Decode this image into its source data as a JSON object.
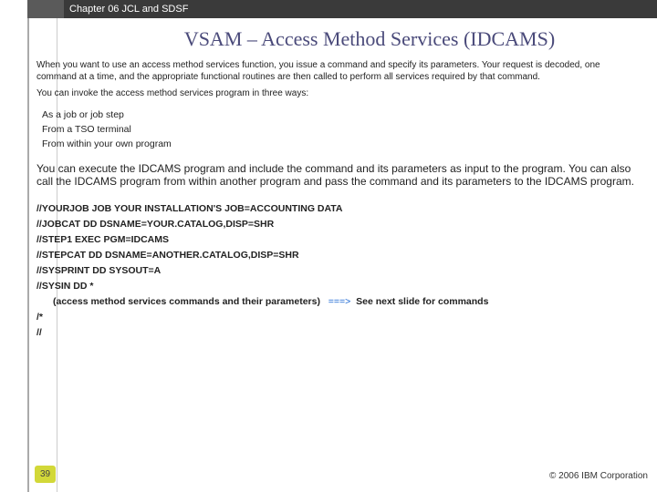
{
  "header": {
    "chapter": "Chapter 06 JCL and SDSF"
  },
  "title": "VSAM – Access Method Services (IDCAMS)",
  "intro1": "When you want to use an access method services function, you issue a command and specify its parameters. Your request is decoded, one command at a time, and the appropriate functional routines are then called to perform all services required by that command.",
  "intro2": "You can invoke the access method services program in three ways:",
  "methods": [
    "As a job or job step",
    "From a TSO terminal",
    "From within your own program"
  ],
  "para2": "You can execute the IDCAMS program and include the command and its parameters as input to the program. You can also call the IDCAMS program from within another program and pass the command and its parameters to the IDCAMS program.",
  "jcl": [
    "//YOURJOB JOB YOUR INSTALLATION'S JOB=ACCOUNTING DATA",
    "//JOBCAT DD DSNAME=YOUR.CATALOG,DISP=SHR",
    "//STEP1 EXEC PGM=IDCAMS",
    "//STEPCAT DD DSNAME=ANOTHER.CATALOG,DISP=SHR",
    "//SYSPRINT DD SYSOUT=A",
    "//SYSIN DD *"
  ],
  "jcl_indent": "(access method services commands and their parameters)",
  "arrow": "===>",
  "nextslide": "See next slide for commands",
  "jcl_tail": [
    "/*",
    "//"
  ],
  "footer": {
    "page": "39",
    "copyright": "© 2006 IBM Corporation"
  }
}
